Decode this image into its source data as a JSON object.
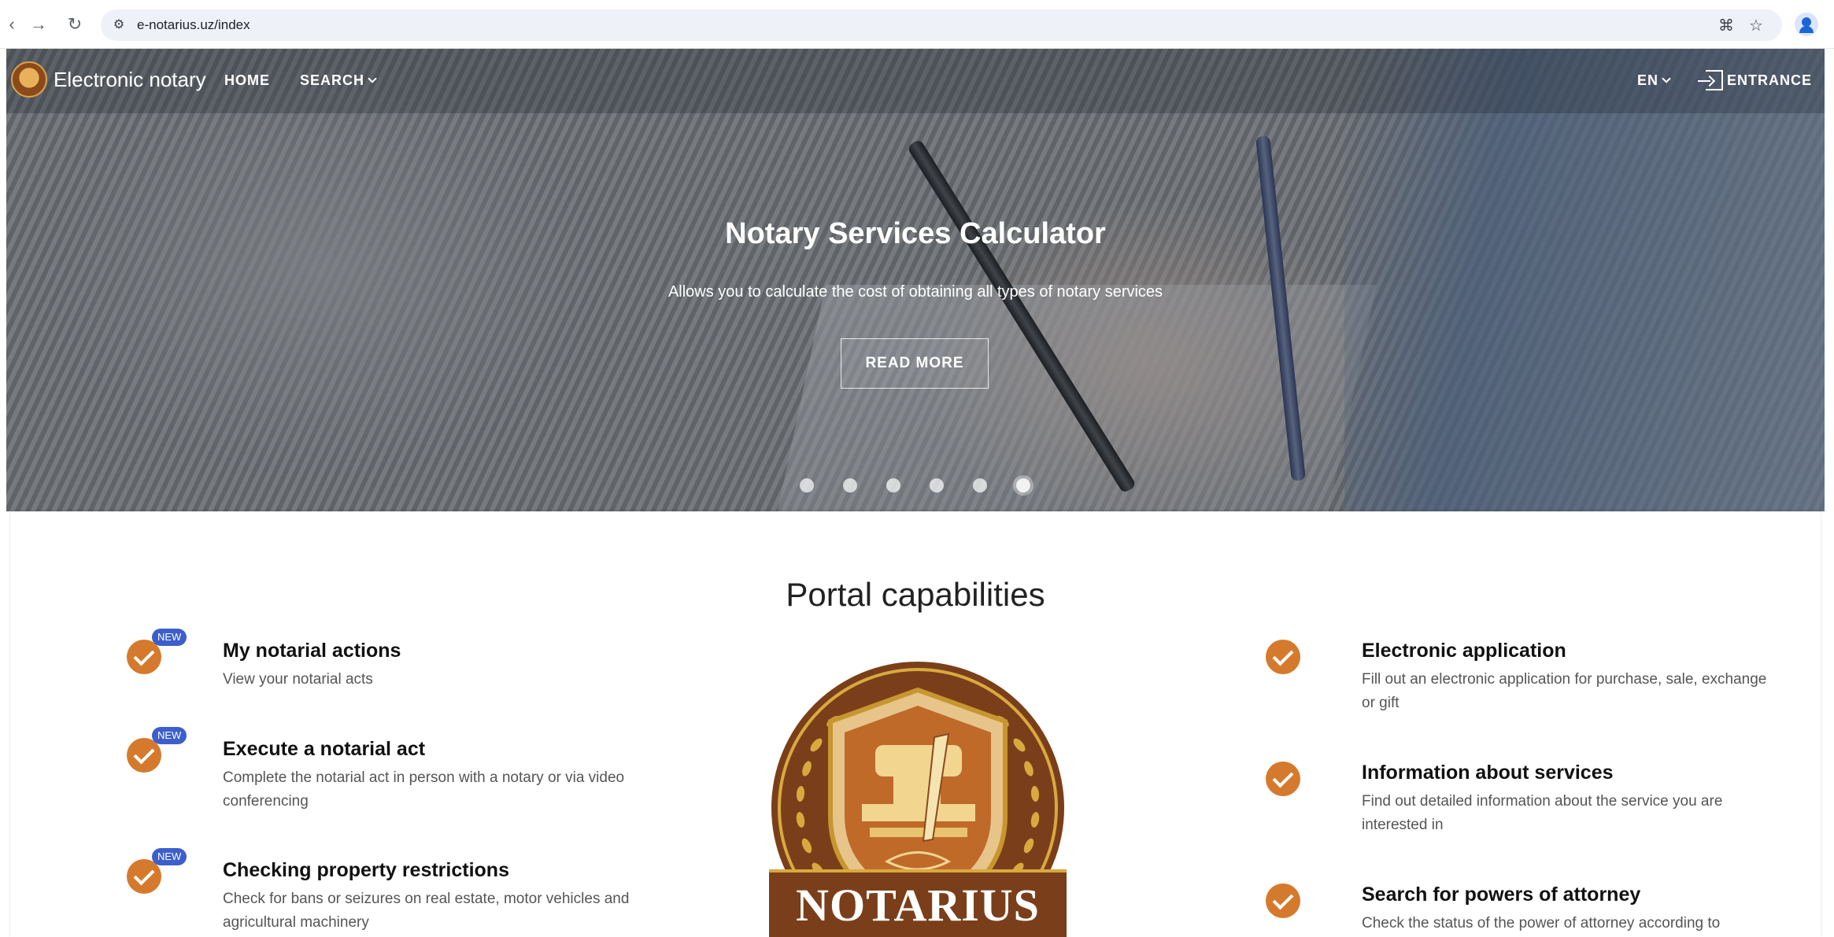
{
  "browser": {
    "url": "e-notarius.uz/index",
    "icons": [
      "back-icon",
      "forward-icon",
      "reload-icon",
      "site-settings-icon",
      "translate-icon",
      "bookmark-star-icon",
      "profile-icon"
    ]
  },
  "nav": {
    "brand": "Electronic notary",
    "home": "HOME",
    "search": "SEARCH",
    "language": "EN",
    "entrance": "ENTRANCE"
  },
  "hero": {
    "title": "Notary Services Calculator",
    "subtitle": "Allows you to calculate the cost of obtaining all types of notary services",
    "button": "READ MORE",
    "slides_count": 6,
    "active_slide": 6
  },
  "main": {
    "title": "Portal capabilities",
    "left_features": [
      {
        "badge": "NEW",
        "title": "My notarial actions",
        "desc": "View your notarial acts"
      },
      {
        "badge": "NEW",
        "title": "Execute a notarial act",
        "desc": "Complete the notarial act in person with a notary or via video conferencing"
      },
      {
        "badge": "NEW",
        "title": "Checking property restrictions",
        "desc": "Check for bans or seizures on real estate, motor vehicles and agricultural machinery"
      }
    ],
    "right_features": [
      {
        "title": "Electronic application",
        "desc": "Fill out an electronic application for purchase, sale, exchange or gift"
      },
      {
        "title": "Information about services",
        "desc": "Find out detailed information about the service you are interested in"
      },
      {
        "title": "Search for powers of attorney",
        "desc": "Check the status of the power of attorney according to"
      }
    ],
    "emblem_text": "NOTARIUS"
  },
  "colors": {
    "accent_orange": "#d57a2d",
    "badge_blue": "#3d5fcc",
    "emblem_brown": "#7a3f1a",
    "emblem_gold": "#d9a93e"
  }
}
